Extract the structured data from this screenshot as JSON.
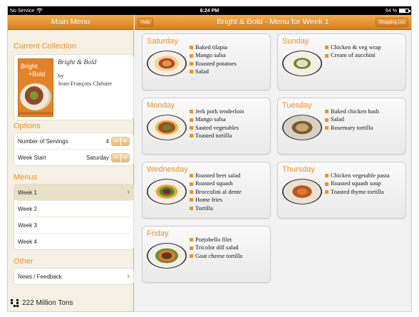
{
  "statusbar": {
    "carrier": "No Service",
    "time": "6:24 PM",
    "battery": "64 %"
  },
  "sidebar": {
    "header": "Main Menu",
    "collection": {
      "section": "Current Collection",
      "cover_word1": "Bright",
      "cover_word2": "+Bold",
      "title": "Bright & Bold",
      "by": "by",
      "author": "Jean-François Chénier"
    },
    "options": {
      "section": "Options",
      "servings_label": "Number of Servings",
      "servings_value": "4",
      "weekstart_label": "Week Start",
      "weekstart_value": "Saturday",
      "minus": "−",
      "plus": "+"
    },
    "menus": {
      "section": "Menus",
      "items": [
        {
          "label": "Week 1"
        },
        {
          "label": "Week 2"
        },
        {
          "label": "Week 3"
        },
        {
          "label": "Week 4"
        }
      ]
    },
    "other": {
      "section": "Other",
      "feedback": "News / Feedback"
    },
    "footer": "222 Million Tons"
  },
  "main": {
    "title": "Bright & Bold - Menu for Week 1",
    "help": "Help",
    "shopping": "Shopping List",
    "days": [
      {
        "name": "Saturday",
        "items": [
          "Baked tilapia",
          "Mango salsa",
          "Roasted potatoes",
          "Salad"
        ]
      },
      {
        "name": "Sunday",
        "items": [
          "Chicken & veg wrap",
          "Cream of zucchini"
        ]
      },
      {
        "name": "Monday",
        "items": [
          "Jerk pork tenderloin",
          "Mango salsa",
          "Sauted vegetables",
          "Toasted tortilla"
        ]
      },
      {
        "name": "Tuesday",
        "items": [
          "Baked chicken hash",
          "Salad",
          "Rosemary tortilla"
        ]
      },
      {
        "name": "Wednesday",
        "items": [
          "Roasted beet salad",
          "Roasted squash",
          "Broccolini al dente",
          "Home fries",
          "Tortilla"
        ]
      },
      {
        "name": "Thursday",
        "items": [
          "Chicken vegetable pasta",
          "Roasted squash soup",
          "Toasted thyme tortilla"
        ]
      },
      {
        "name": "Friday",
        "items": [
          "Portobello filet",
          "Tricolor dill salad",
          "Goat cheese tortilla"
        ]
      }
    ]
  },
  "colors": {
    "accent": "#e8912d",
    "header": "#de8a26"
  }
}
